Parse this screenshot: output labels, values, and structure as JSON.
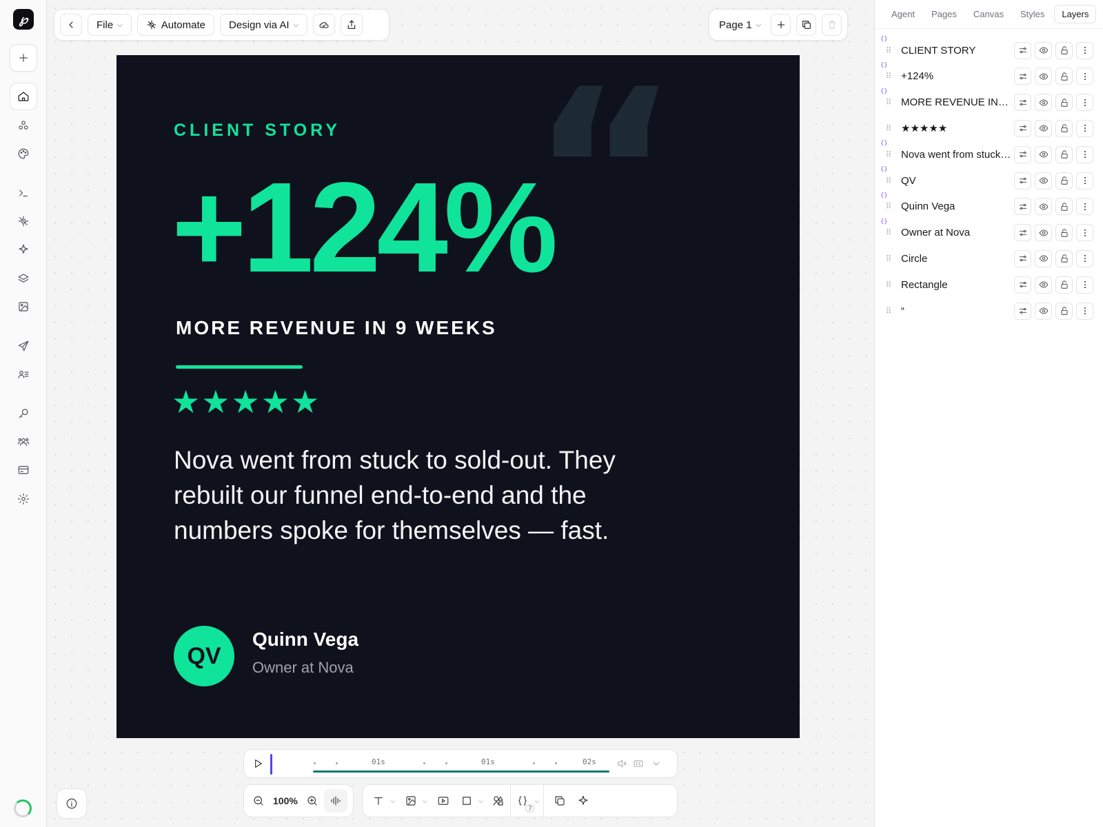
{
  "toolbar": {
    "file_label": "File",
    "automate_label": "Automate",
    "design_ai_label": "Design via AI",
    "page_label": "Page 1"
  },
  "panel": {
    "tabs": [
      {
        "label": "Agent"
      },
      {
        "label": "Pages"
      },
      {
        "label": "Canvas"
      },
      {
        "label": "Styles"
      },
      {
        "label": "Layers"
      }
    ],
    "active_tab": "Layers",
    "layers": [
      {
        "name": "CLIENT STORY",
        "variable": true
      },
      {
        "name": "+124%",
        "variable": true
      },
      {
        "name": "MORE REVENUE IN 9 WEEKS",
        "variable": true
      },
      {
        "name": "★★★★★",
        "variable": false
      },
      {
        "name": "Nova went from stuck to sold-out.",
        "variable": true
      },
      {
        "name": "QV",
        "variable": true
      },
      {
        "name": "Quinn Vega",
        "variable": true
      },
      {
        "name": "Owner at Nova",
        "variable": true
      },
      {
        "name": "Circle",
        "variable": false
      },
      {
        "name": "Rectangle",
        "variable": false
      },
      {
        "name": "“",
        "variable": false
      }
    ]
  },
  "artboard": {
    "kicker": "CLIENT STORY",
    "headline": "+124%",
    "subheadline": "MORE REVENUE IN 9 WEEKS",
    "stars": "★★★★★",
    "rating": 5,
    "quote": "Nova went from stuck to sold-out. They rebuilt our funnel end-to-end and the numbers spoke for themselves — fast.",
    "quote_mark": "“",
    "avatar_initials": "QV",
    "person_name": "Quinn Vega",
    "person_role": "Owner at Nova",
    "colors": {
      "background": "#0f111d",
      "accent": "#10e39a",
      "text": "#f4f4f5",
      "muted": "#9ca3af"
    }
  },
  "timeline": {
    "labels": [
      "01s",
      "01s",
      "02s"
    ]
  },
  "zoom": {
    "value": "100%"
  },
  "variables_count": "7",
  "icons": [
    "logo",
    "plus-icon",
    "home-icon",
    "components-icon",
    "palette-icon",
    "terminal-icon",
    "automation-icon",
    "sparkle-icon",
    "layers-icon",
    "image-icon",
    "send-icon",
    "contacts-icon",
    "key-icon",
    "team-icon",
    "billing-icon",
    "settings-icon"
  ]
}
